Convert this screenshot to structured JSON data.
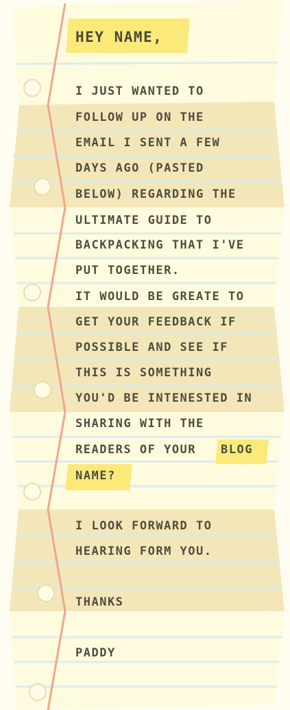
{
  "note": {
    "greeting": "HEY NAME,",
    "body_lines": [
      "I JUST WANTED TO",
      "FOLLOW UP ON THE",
      "EMAIL I SENT A FEW",
      "DAYS AGO (PASTED",
      "BELOW) REGARDING THE",
      "ULTIMATE GUIDE TO",
      "BACKPACKING THAT I'VE",
      "PUT TOGETHER.",
      "IT WOULD BE GREATE TO",
      "GET YOUR FEEDBACK IF",
      "POSSIBLE AND SEE IF",
      "THIS IS SOMETHING",
      "YOU'D BE INTENESTED IN",
      "SHARING WITH THE",
      "READERS OF YOUR"
    ],
    "highlight_blog": "BLOG",
    "highlight_name": "NAME?",
    "closing_line_1": "I LOOK FORWARD TO",
    "closing_line_2": "HEARING FORM YOU.",
    "thanks": "THANKS",
    "signature": "PADDY",
    "colors": {
      "page_background": "#fffdf2",
      "paper_light": "#fefbdf",
      "paper_shade": "#f3e7b9",
      "rule_line": "#d8ecec",
      "margin_line": "#f0a68c",
      "highlight": "#fbe97a",
      "text": "#4e4e40"
    }
  }
}
